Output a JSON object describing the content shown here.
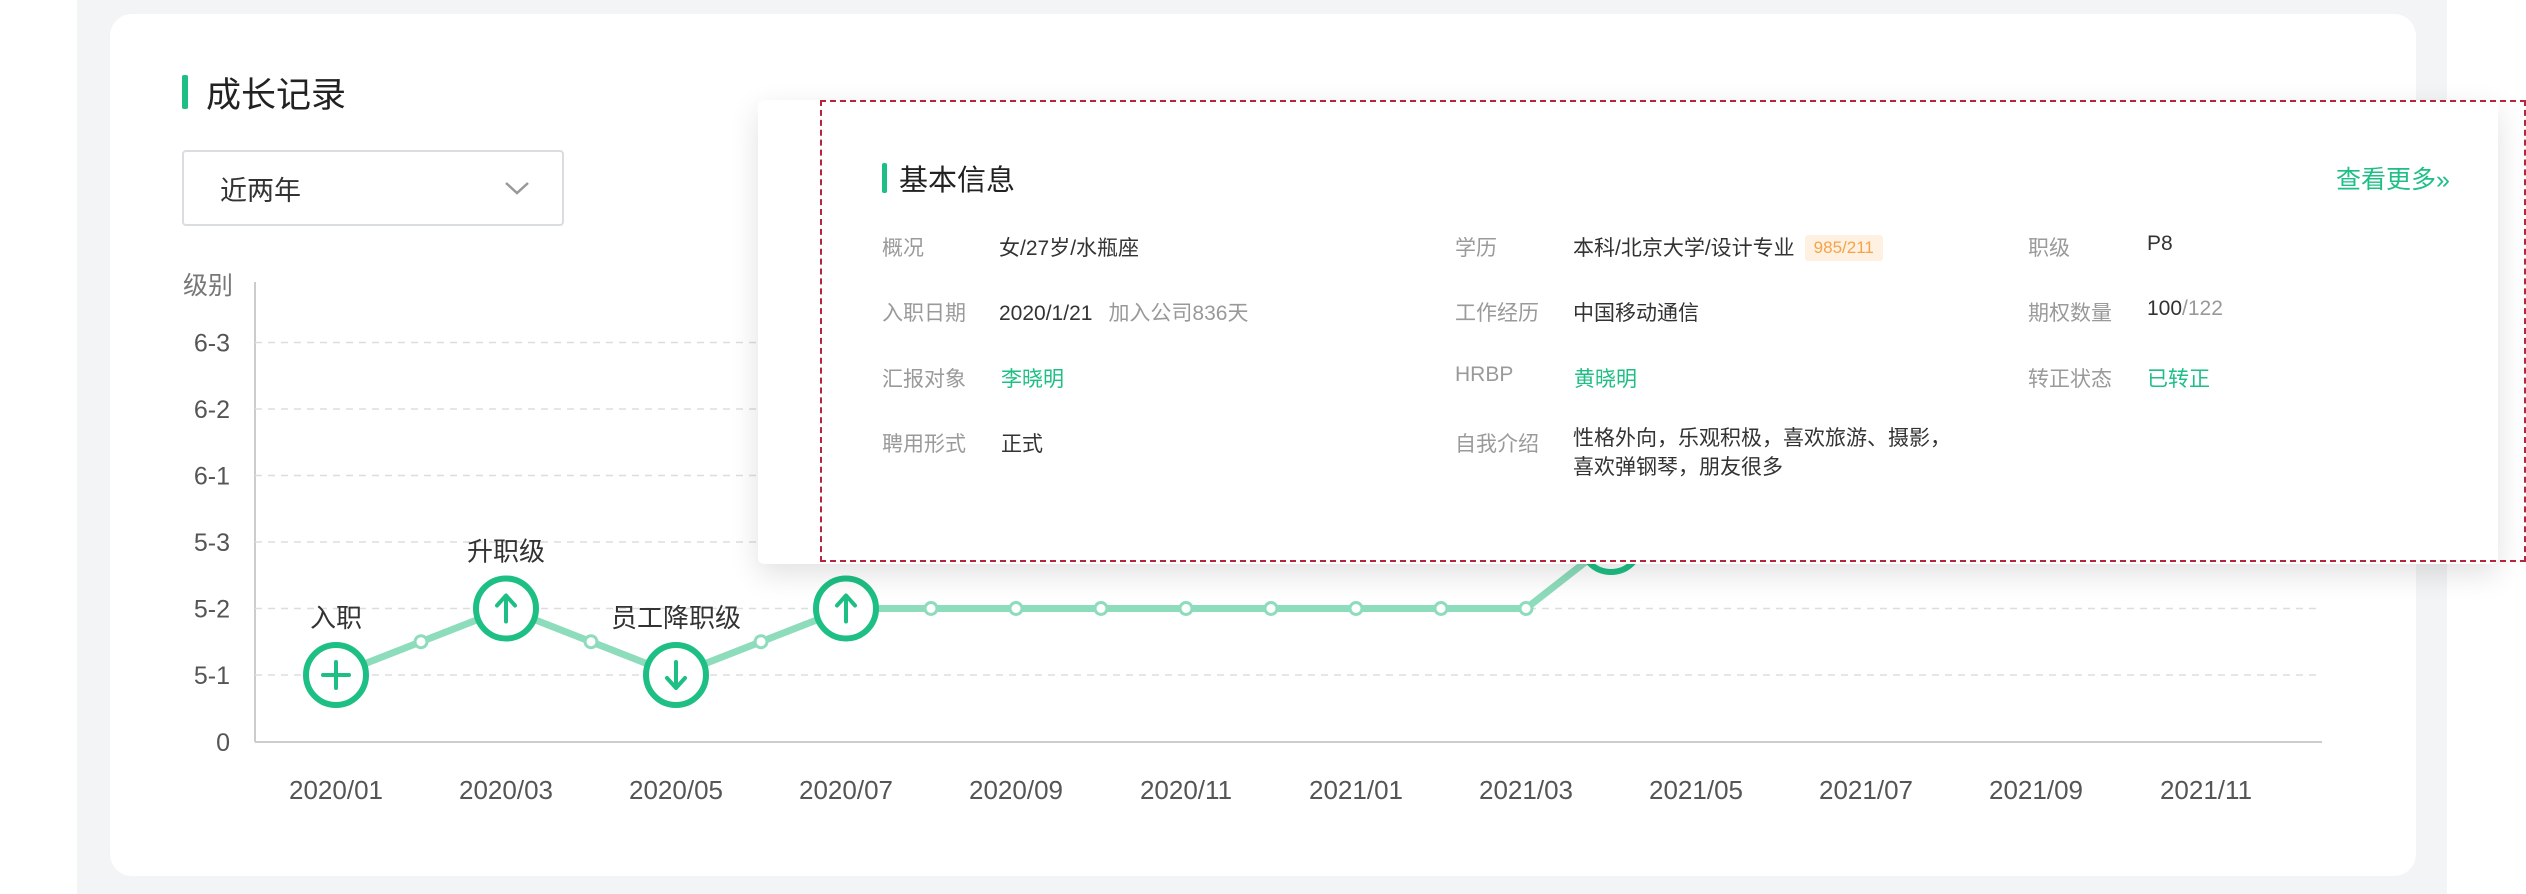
{
  "section": {
    "title": "成长记录"
  },
  "filter": {
    "selected": "近两年"
  },
  "chart_data": {
    "type": "line",
    "ylabel": "级别",
    "y_levels": [
      "0",
      "5-1",
      "5-2",
      "5-3",
      "6-1",
      "6-2",
      "6-3"
    ],
    "x_ticks": [
      "2020/01",
      "2020/03",
      "2020/05",
      "2020/07",
      "2020/09",
      "2020/11",
      "2021/01",
      "2021/03",
      "2021/05",
      "2021/07",
      "2021/09",
      "2021/11"
    ],
    "series": [
      {
        "points": [
          {
            "x": "2020/01",
            "y": "5-1",
            "event": "join",
            "label": "入职"
          },
          {
            "x": "2020/02",
            "y": "5-1.5"
          },
          {
            "x": "2020/03",
            "y": "5-2",
            "event": "up",
            "label": "升职级"
          },
          {
            "x": "2020/04",
            "y": "5-1.5"
          },
          {
            "x": "2020/05",
            "y": "5-1",
            "event": "down",
            "label": "员工降职级"
          },
          {
            "x": "2020/06",
            "y": "5-1.5"
          },
          {
            "x": "2020/07",
            "y": "5-2",
            "event": "up"
          },
          {
            "x": "2020/08",
            "y": "5-2"
          },
          {
            "x": "2020/09",
            "y": "5-2"
          },
          {
            "x": "2020/10",
            "y": "5-2"
          },
          {
            "x": "2020/11",
            "y": "5-2"
          },
          {
            "x": "2020/12",
            "y": "5-2"
          },
          {
            "x": "2021/01",
            "y": "5-2"
          },
          {
            "x": "2021/02",
            "y": "5-2"
          },
          {
            "x": "2021/03",
            "y": "5-2"
          },
          {
            "x": "2021/04",
            "y": "5-3",
            "event": "up"
          }
        ]
      }
    ],
    "colors": {
      "line": "#8ddcbc",
      "marker": "#1dbf84",
      "grid": "#dddddd",
      "axis_text": "#555555"
    }
  },
  "basic_info": {
    "title": "基本信息",
    "more": "查看更多»",
    "rows": [
      [
        {
          "label": "概况",
          "value": "女/27岁/水瓶座"
        },
        {
          "label": "学历",
          "value": "本科/北京大学/设计专业",
          "tag": "985/211"
        },
        {
          "label": "职级",
          "value": "P8"
        }
      ],
      [
        {
          "label": "入职日期",
          "value": "2020/1/21",
          "extra": "加入公司836天"
        },
        {
          "label": "工作经历",
          "value": "中国移动通信"
        },
        {
          "label": "期权数量",
          "value": "100",
          "value_suffix": "/122"
        }
      ],
      [
        {
          "label": "汇报对象",
          "value": "李晓明",
          "link": true
        },
        {
          "label": "HRBP",
          "value": "黄晓明",
          "link": true
        },
        {
          "label": "转正状态",
          "value": "已转正",
          "link": true
        }
      ],
      [
        {
          "label": "聘用形式",
          "value": "正式"
        },
        {
          "label": "自我介绍",
          "lines": [
            "性格外向，乐观积极，喜欢旅游、摄影，",
            "喜欢弹钢琴，朋友很多"
          ]
        }
      ]
    ]
  }
}
